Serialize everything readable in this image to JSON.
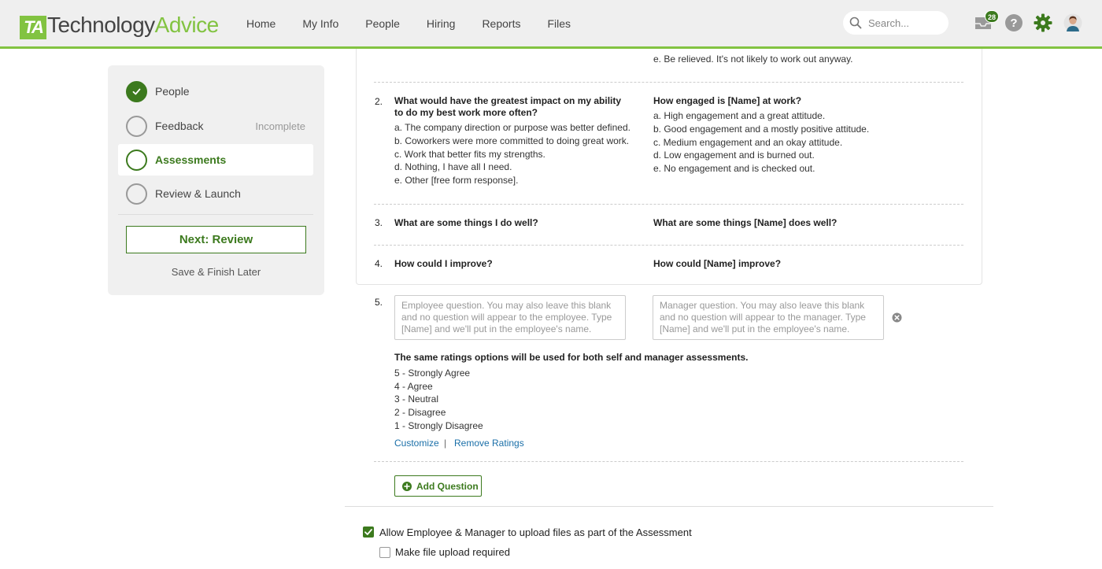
{
  "header": {
    "logo_mark": "TA",
    "logo_part1": "Technology",
    "logo_part2": "Advice",
    "nav": [
      "Home",
      "My Info",
      "People",
      "Hiring",
      "Reports",
      "Files"
    ],
    "search_placeholder": "Search...",
    "inbox_count": "28",
    "accent_color": "#82c341"
  },
  "sidebar": {
    "steps": [
      {
        "label": "People",
        "state": "done"
      },
      {
        "label": "Feedback",
        "status": "Incomplete",
        "state": "todo"
      },
      {
        "label": "Assessments",
        "state": "current"
      },
      {
        "label": "Review & Launch",
        "state": "todo"
      }
    ],
    "next_button": "Next: Review",
    "save_later": "Save & Finish Later"
  },
  "questions": {
    "prev_tail": "e. Be relieved. It's not likely to work out anyway.",
    "items": [
      {
        "number": "2.",
        "employee_q": "What would have the greatest impact on my ability to do my best work more often?",
        "employee_opts": [
          "a. The company direction or purpose was better defined.",
          "b. Coworkers were more committed to doing great work.",
          "c. Work that better fits my strengths.",
          "d. Nothing, I have all I need.",
          "e. Other [free form response]."
        ],
        "manager_q": "How engaged is [Name] at work?",
        "manager_opts": [
          "a. High engagement and a great attitude.",
          "b. Good engagement and a mostly positive attitude.",
          "c. Medium engagement and an okay attitude.",
          "d. Low engagement and is burned out.",
          "e. No engagement and is checked out."
        ]
      },
      {
        "number": "3.",
        "employee_q": "What are some things I do well?",
        "manager_q": "What are some things [Name] does well?"
      },
      {
        "number": "4.",
        "employee_q": "How could I improve?",
        "manager_q": "How could [Name] improve?"
      }
    ]
  },
  "new_question": {
    "number": "5.",
    "employee_placeholder": "Employee question. You may also leave this blank and no question will appear to the employee. Type [Name] and we'll put in the employee's name.",
    "manager_placeholder": "Manager question. You may also leave this blank and no question will appear to the manager. Type [Name] and we'll put in the employee's name.",
    "ratings_title": "The same ratings options will be used for both self and manager assessments.",
    "ratings": [
      "5 - Strongly Agree",
      "4 - Agree",
      "3 - Neutral",
      "2 - Disagree",
      "1 - Strongly Disagree"
    ],
    "customize": "Customize",
    "separator": "|",
    "remove_ratings": "Remove Ratings",
    "add_question": "Add Question"
  },
  "options": {
    "allow_upload": "Allow Employee & Manager to upload files as part of the Assessment",
    "allow_upload_checked": true,
    "upload_required": "Make file upload required",
    "upload_required_checked": false
  }
}
